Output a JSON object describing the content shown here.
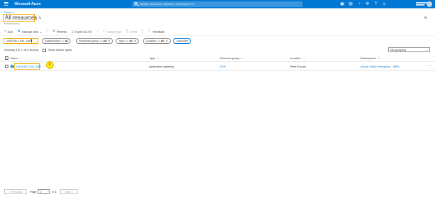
{
  "topbar": {
    "brand": "Microsoft Azure",
    "search_placeholder": "Search resources, services, and docs (G+/)",
    "icons": [
      "portal-icon",
      "cloud-shell-icon",
      "bell-icon",
      "gear-icon",
      "help-icon",
      "feedback-icon"
    ]
  },
  "breadcrumb": {
    "home": "Home",
    "sep": ">"
  },
  "page": {
    "title": "All resources",
    "subtitle": "Default Directory",
    "close": "×"
  },
  "commands": {
    "add": "Add",
    "manage_view": "Manage view",
    "refresh": "Refresh",
    "export_csv": "Export to CSV",
    "assign_tags": "Assign tags",
    "delete": "Delete",
    "feedback": "Feedback"
  },
  "filters": {
    "name_value": "VISZHAO_HA_GAR",
    "subscription": {
      "label": "Subscription == ",
      "value": "all"
    },
    "resource_group": {
      "label": "Resource group == ",
      "value": "all"
    },
    "type": {
      "label": "Type == ",
      "value": "all"
    },
    "location": {
      "label": "Location == ",
      "value": "all"
    },
    "add_filter": "Add filter"
  },
  "summary": {
    "showing": "Showing 1 to 1 of 1 records.",
    "show_hidden": "Show hidden types",
    "grouping": "No grouping"
  },
  "table": {
    "headers": {
      "name": "Name",
      "type": "Type",
      "resource_group": "Resource group",
      "location": "Location",
      "subscription": "Subscription"
    },
    "rows": [
      {
        "name": "VISZHAO_HA_GAR",
        "type": "Application gateway",
        "resource_group": "GAR",
        "location": "West Europe",
        "subscription": "Visual Studio Enterprise – MPN"
      }
    ],
    "info_badge": "i",
    "more": "···"
  },
  "pager": {
    "previous": "< Previous",
    "page_label": "Page",
    "page_value": "1",
    "of": "of 1",
    "next": "Next >"
  },
  "colors": {
    "accent": "#0078d4",
    "highlight": "#f2a900",
    "badge": "#f8e71c"
  }
}
